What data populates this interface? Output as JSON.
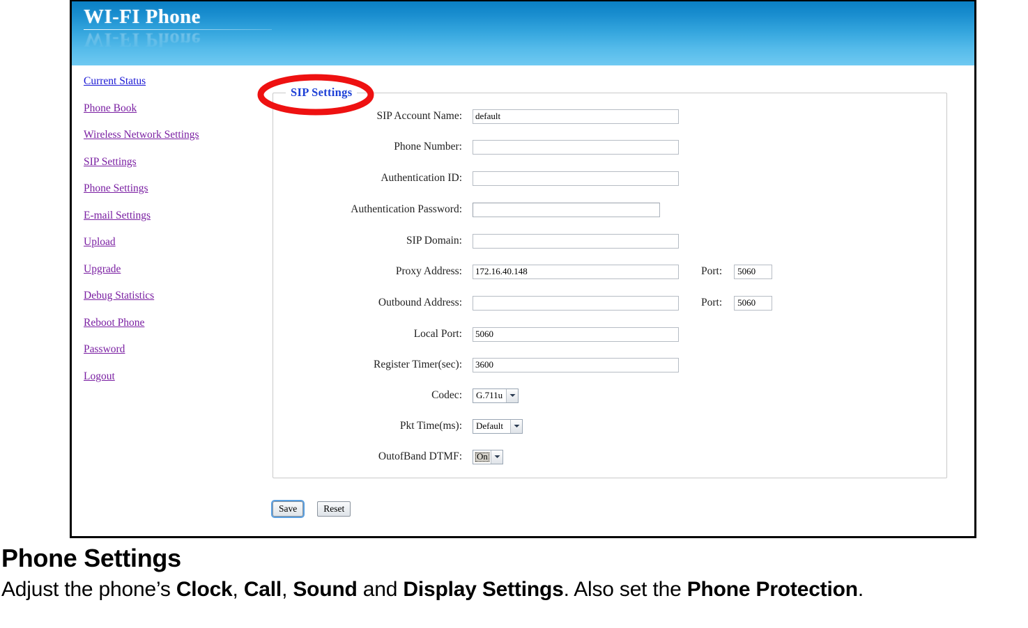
{
  "header": {
    "title": "WI-FI Phone"
  },
  "sidebar": {
    "items": [
      {
        "label": "Current Status",
        "visited": false
      },
      {
        "label": "Phone Book",
        "visited": true
      },
      {
        "label": "Wireless Network Settings",
        "visited": true
      },
      {
        "label": "SIP Settings",
        "visited": true
      },
      {
        "label": "Phone Settings",
        "visited": true
      },
      {
        "label": "E-mail Settings",
        "visited": true
      },
      {
        "label": "Upload",
        "visited": true
      },
      {
        "label": "Upgrade",
        "visited": true
      },
      {
        "label": "Debug Statistics",
        "visited": true
      },
      {
        "label": "Reboot Phone",
        "visited": true
      },
      {
        "label": "Password",
        "visited": true
      },
      {
        "label": "Logout",
        "visited": true
      }
    ]
  },
  "form": {
    "legend": "SIP Settings",
    "fields": {
      "sip_account_name": {
        "label": "SIP Account Name:",
        "value": "default"
      },
      "phone_number": {
        "label": "Phone Number:",
        "value": ""
      },
      "authentication_id": {
        "label": "Authentication ID:",
        "value": ""
      },
      "authentication_password": {
        "label": "Authentication Password:",
        "value": ""
      },
      "sip_domain": {
        "label": "SIP Domain:",
        "value": ""
      },
      "proxy_address": {
        "label": "Proxy Address:",
        "value": "172.16.40.148"
      },
      "proxy_port": {
        "label": "Port:",
        "value": "5060"
      },
      "outbound_address": {
        "label": "Outbound Address:",
        "value": ""
      },
      "outbound_port": {
        "label": "Port:",
        "value": "5060"
      },
      "local_port": {
        "label": "Local Port:",
        "value": "5060"
      },
      "register_timer": {
        "label": "Register Timer(sec):",
        "value": "3600"
      },
      "codec": {
        "label": "Codec:",
        "value": "G.711u"
      },
      "pkt_time": {
        "label": "Pkt Time(ms):",
        "value": "Default"
      },
      "outofband_dtmf": {
        "label": "OutofBand DTMF:",
        "value": "On"
      }
    }
  },
  "buttons": {
    "save": "Save",
    "reset": "Reset"
  },
  "annotation": {
    "color": "#ee1111",
    "target": "SIP Settings"
  },
  "caption": {
    "heading": "Phone Settings",
    "line_parts": [
      {
        "text": "Adjust the phone’s ",
        "bold": false
      },
      {
        "text": "Clock",
        "bold": true
      },
      {
        "text": ", ",
        "bold": false
      },
      {
        "text": "Call",
        "bold": true
      },
      {
        "text": ", ",
        "bold": false
      },
      {
        "text": "Sound",
        "bold": true
      },
      {
        "text": " and ",
        "bold": false
      },
      {
        "text": "Display Settings",
        "bold": true
      },
      {
        "text": ". Also set the ",
        "bold": false
      },
      {
        "text": "Phone Protection",
        "bold": true
      },
      {
        "text": ".",
        "bold": false
      }
    ]
  },
  "colors": {
    "header_top": "#0a7fc4",
    "header_bottom": "#6fc9f2",
    "link_visited": "#7a1fa2",
    "link_fresh": "#1a17d4",
    "legend": "#1c3fd6",
    "annotation_red": "#ee1111"
  }
}
